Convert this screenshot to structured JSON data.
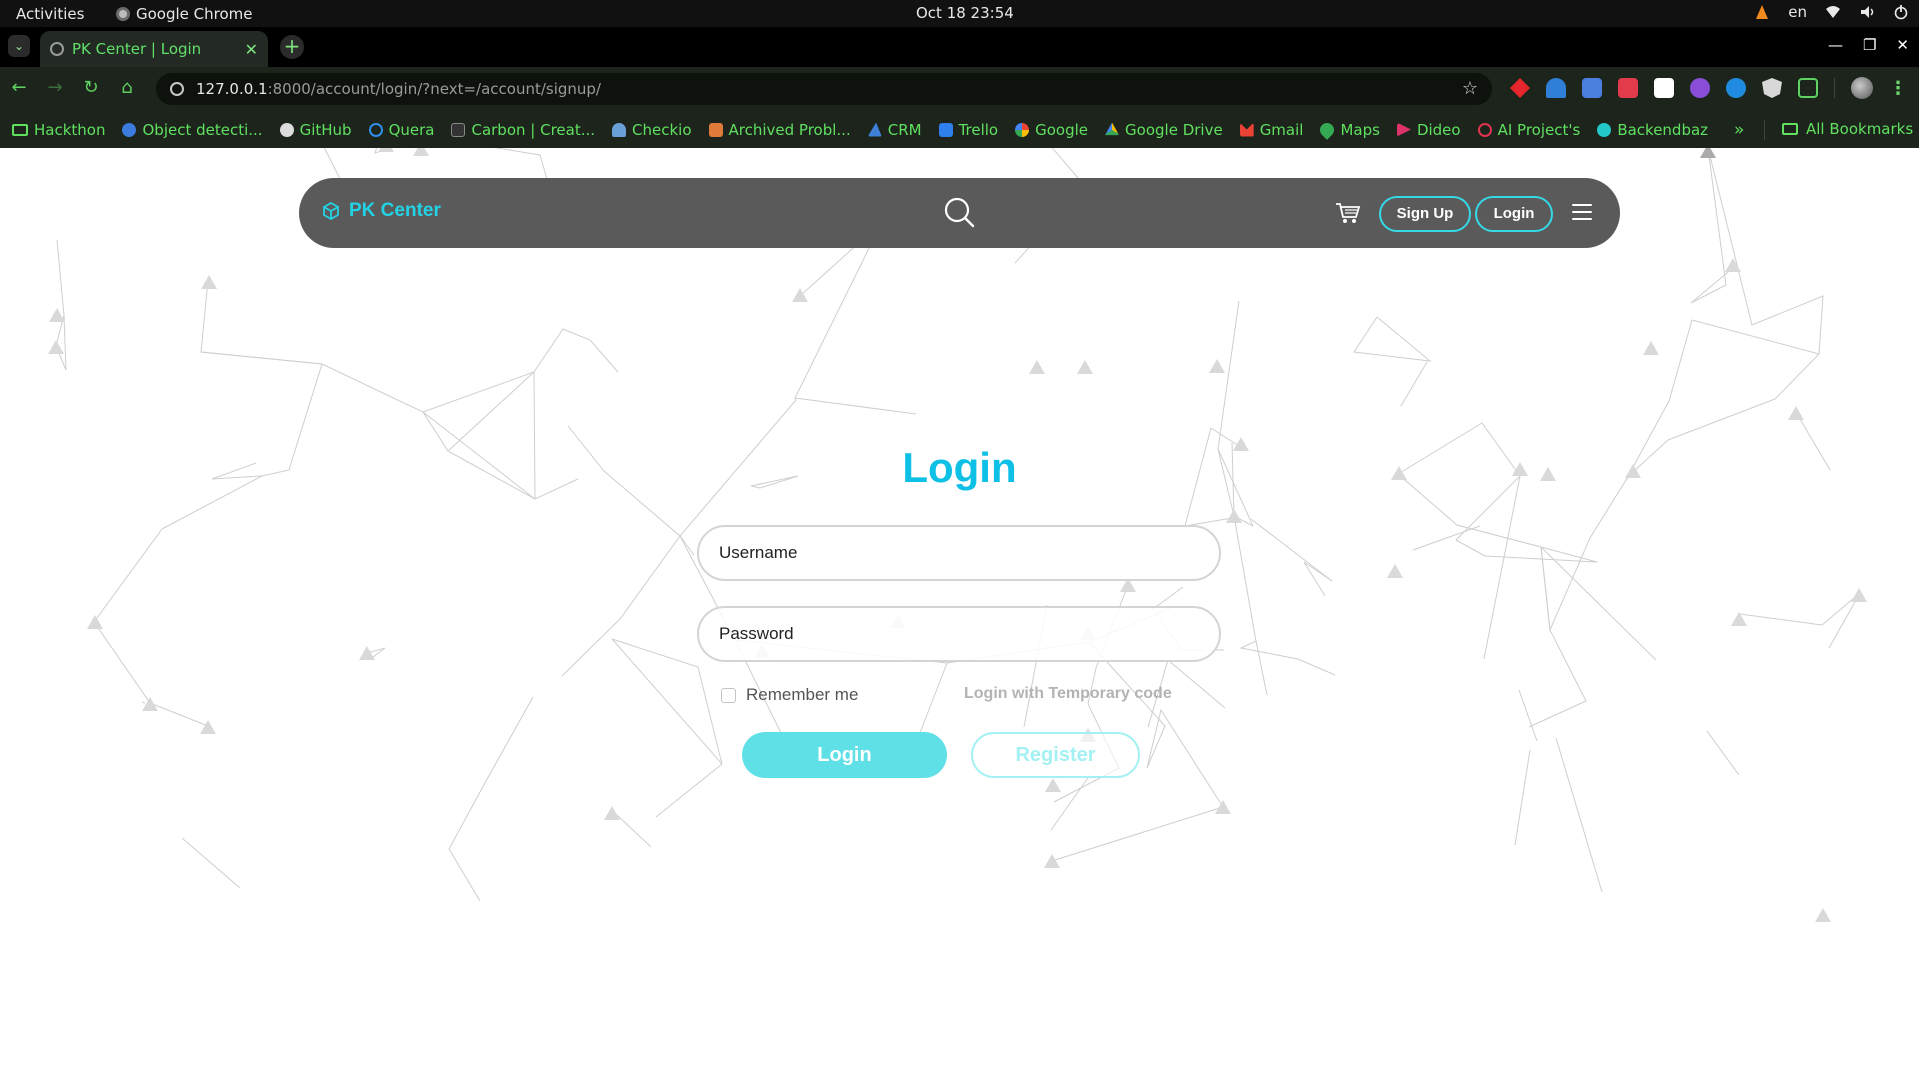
{
  "os": {
    "activities": "Activities",
    "app_name": "Google Chrome",
    "clock": "Oct 18  23:54",
    "language": "en"
  },
  "browser": {
    "tab_title": "PK Center | Login",
    "url_host": "127.0.0.1",
    "url_path": ":8000/account/login/?next=/account/signup/",
    "bookmarks": [
      {
        "label": "Hackthon",
        "icon": "folder-icon",
        "color": "#5fe05f"
      },
      {
        "label": "Object detecti...",
        "icon": "p-icon",
        "color": "#3b7bdc"
      },
      {
        "label": "GitHub",
        "icon": "github-icon",
        "color": "#dddddd"
      },
      {
        "label": "Quera",
        "icon": "quera-icon",
        "color": "#2f8fe8"
      },
      {
        "label": "Carbon | Creat...",
        "icon": "carbon-icon",
        "color": "#333333"
      },
      {
        "label": "Checkio",
        "icon": "checkio-icon",
        "color": "#6aa0d8"
      },
      {
        "label": "Archived Probl...",
        "icon": "pe-icon",
        "color": "#e07a3b"
      },
      {
        "label": "CRM",
        "icon": "crm-icon",
        "color": "#3e7fd8"
      },
      {
        "label": "Trello",
        "icon": "trello-icon",
        "color": "#2f80ed"
      },
      {
        "label": "Google",
        "icon": "google-icon",
        "color": "#ea4335"
      },
      {
        "label": "Google Drive",
        "icon": "drive-icon",
        "color": "#fbbc04"
      },
      {
        "label": "Gmail",
        "icon": "gmail-icon",
        "color": "#ea4335"
      },
      {
        "label": "Maps",
        "icon": "maps-icon",
        "color": "#34a853"
      },
      {
        "label": "Dideo",
        "icon": "dideo-icon",
        "color": "#e0336b"
      },
      {
        "label": "AI Project's",
        "icon": "ai-icon",
        "color": "#e03350"
      },
      {
        "label": "Backendbaz",
        "icon": "backendbaz-icon",
        "color": "#22c7c7"
      }
    ],
    "bookmarks_overflow": "»",
    "all_bookmarks": "All Bookmarks"
  },
  "site": {
    "brand": "PK Center",
    "signup_label": "Sign Up",
    "login_label": "Login",
    "accent": "#0fc0e6"
  },
  "login_form": {
    "title": "Login",
    "username_placeholder": "Username",
    "password_placeholder": "Password",
    "remember_label": "Remember me",
    "temp_code_link": "Login with Temporary code",
    "login_button": "Login",
    "register_button": "Register"
  }
}
